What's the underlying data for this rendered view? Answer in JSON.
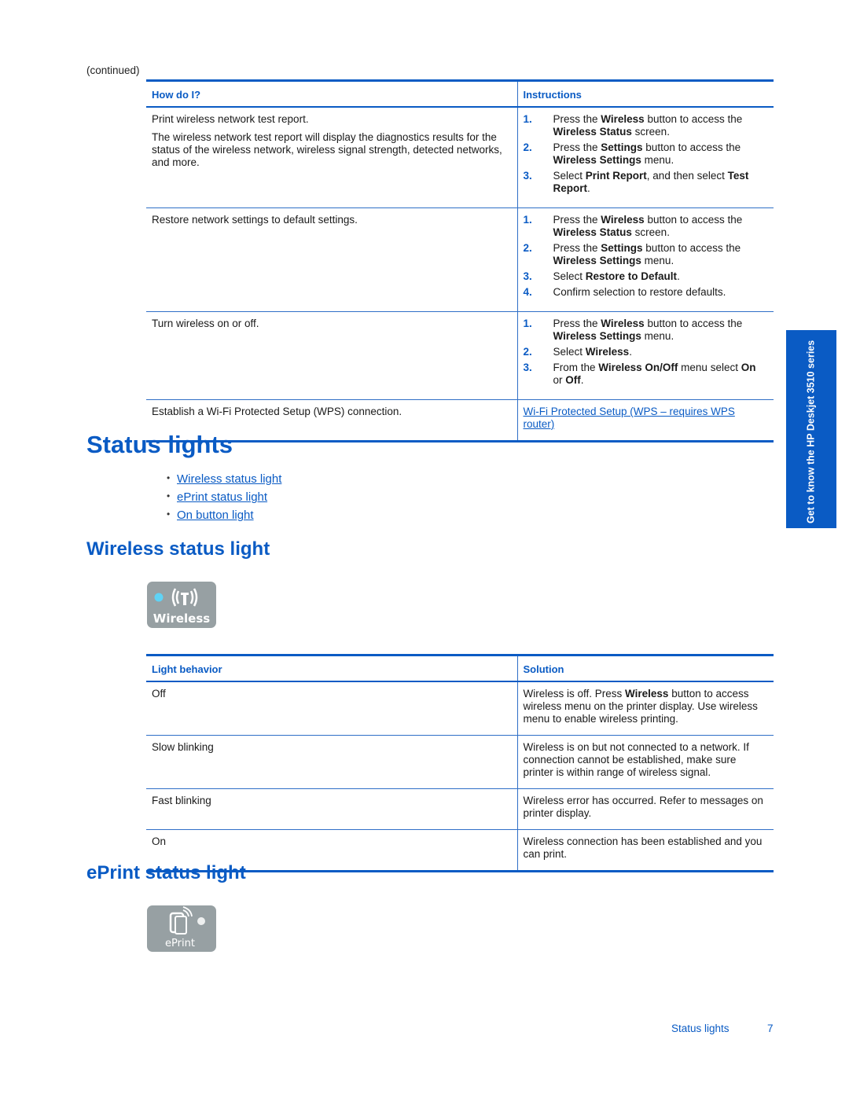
{
  "continued_label": "(continued)",
  "howto_table": {
    "headers": [
      "How do I?",
      "Instructions"
    ],
    "rows": [
      {
        "task": [
          "Print wireless network test report.",
          "The wireless network test report will display the diagnostics results for the status of the wireless network, wireless signal strength, detected networks, and more."
        ],
        "steps": [
          {
            "num": "1.",
            "html": "Press the <b>Wireless</b> button to access the <b>Wireless Status</b> screen."
          },
          {
            "num": "2.",
            "html": "Press the <b>Settings</b> button to access the <b>Wireless Settings</b> menu."
          },
          {
            "num": "3.",
            "html": "Select <b>Print Report</b>, and then select <b>Test Report</b>."
          }
        ]
      },
      {
        "task": [
          "Restore network settings to default settings."
        ],
        "steps": [
          {
            "num": "1.",
            "html": "Press the <b>Wireless</b> button to access the <b>Wireless Status</b> screen."
          },
          {
            "num": "2.",
            "html": "Press the <b>Settings</b> button to access the <b>Wireless Settings</b> menu."
          },
          {
            "num": "3.",
            "html": "Select <b>Restore to Default</b>."
          },
          {
            "num": "4.",
            "html": "Confirm selection to restore defaults."
          }
        ]
      },
      {
        "task": [
          "Turn wireless on or off."
        ],
        "steps": [
          {
            "num": "1.",
            "html": "Press the <b>Wireless</b> button to access the <b>Wireless Settings</b> menu."
          },
          {
            "num": "2.",
            "html": "Select <b>Wireless</b>."
          },
          {
            "num": "3.",
            "html": "From the <b>Wireless On/Off</b> menu select <b>On</b> or <b>Off</b>."
          }
        ]
      },
      {
        "task": [
          "Establish a Wi-Fi Protected Setup (WPS) connection."
        ],
        "link": "Wi-Fi Protected Setup (WPS – requires WPS router)"
      }
    ]
  },
  "status_lights": {
    "title": "Status lights",
    "toc": [
      "Wireless status light",
      "ePrint status light",
      "On button light"
    ]
  },
  "wireless_section": {
    "title": "Wireless status light",
    "panel_label": "Wireless",
    "light_color": "#5fd3f5",
    "table": {
      "headers": [
        "Light behavior",
        "Solution"
      ],
      "rows": [
        {
          "behavior": "Off",
          "solution": "Wireless is off. Press <b>Wireless</b> button to access wireless menu on the printer display. Use wireless menu to enable wireless printing."
        },
        {
          "behavior": "Slow blinking",
          "solution": "Wireless is on but not connected to a network. If connection cannot be established, make sure printer is within range of wireless signal."
        },
        {
          "behavior": "Fast blinking",
          "solution": "Wireless error has occurred. Refer to messages on printer display."
        },
        {
          "behavior": "On",
          "solution": "Wireless connection has been established and you can print."
        }
      ]
    }
  },
  "eprint_section": {
    "title": "ePrint status light",
    "panel_label": "ePrint"
  },
  "side_tab": "Get to know the HP Deskjet 3510 series",
  "footer": {
    "section": "Status lights",
    "page": "7"
  }
}
